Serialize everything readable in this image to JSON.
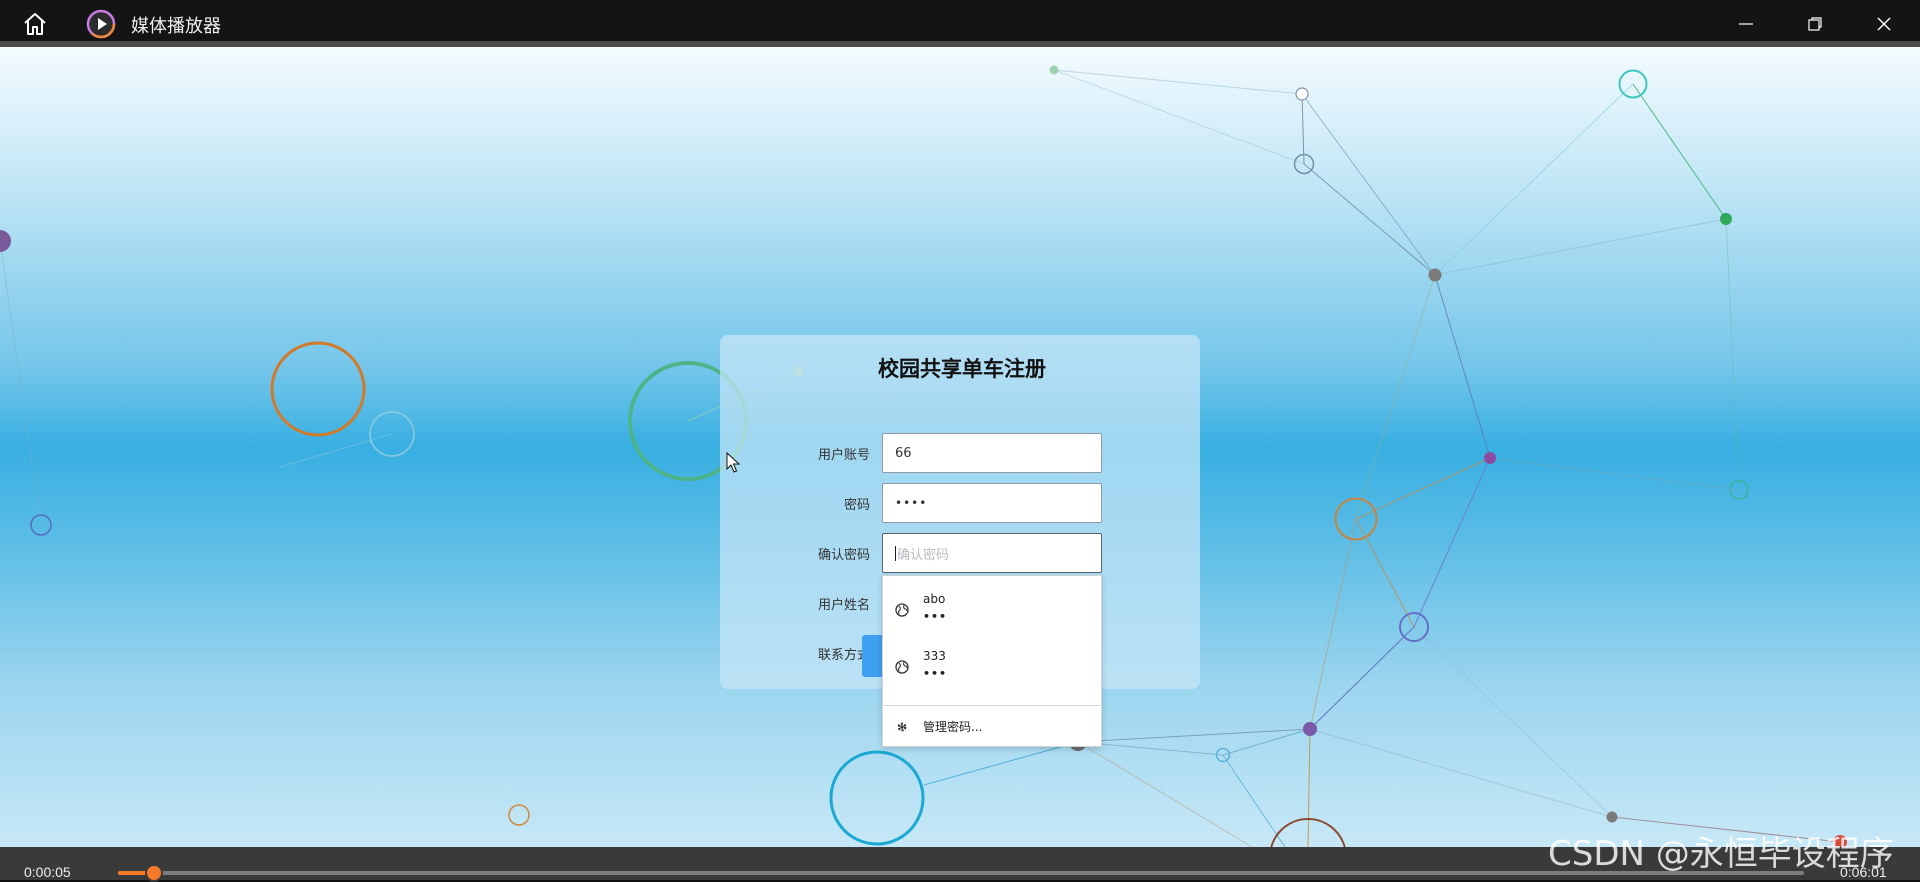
{
  "window": {
    "title": "媒体播放器",
    "icons": {
      "home": "home-icon",
      "app": "play-circle-icon",
      "minimize": "minimize-icon",
      "maximize": "restore-icon",
      "close": "close-icon"
    }
  },
  "form": {
    "title": "校园共享单车注册",
    "fields": [
      {
        "label": "用户账号",
        "value": "66",
        "placeholder": ""
      },
      {
        "label": "密码",
        "value": "••••",
        "placeholder": ""
      },
      {
        "label": "确认密码",
        "value": "",
        "placeholder": "确认密码"
      },
      {
        "label": "用户姓名",
        "value": "",
        "placeholder": ""
      },
      {
        "label": "联系方式",
        "value": "",
        "placeholder": ""
      }
    ]
  },
  "autofill": {
    "items": [
      {
        "username": "abo",
        "password": "•••",
        "icon": "globe-icon"
      },
      {
        "username": "333",
        "password": "•••",
        "icon": "globe-icon"
      }
    ],
    "manage_label": "管理密码...",
    "manage_icon": "gear-icon"
  },
  "player": {
    "current_time": "0:00:05",
    "total_time": "0:06:01",
    "progress": 0.014,
    "accent_color": "#f57a2a"
  },
  "watermark": "CSDN @永恒毕设程序"
}
